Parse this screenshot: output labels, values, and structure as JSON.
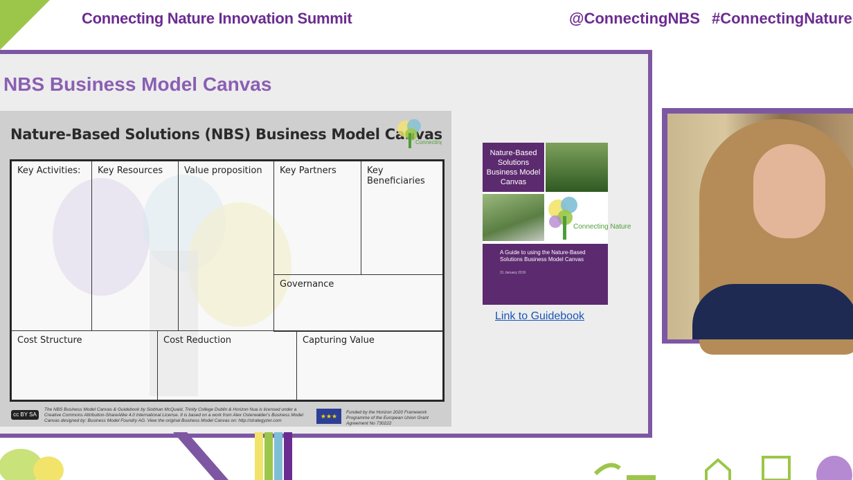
{
  "header": {
    "title": "Connecting Nature Innovation Summit",
    "handle": "@ConnectingNBS",
    "hashtag": "#ConnectingNatureS"
  },
  "slide": {
    "heading": "NBS Business Model Canvas",
    "canvas": {
      "title": "Nature-Based Solutions (NBS) Business Model Canvas",
      "logo_text": "Connecting Nature",
      "cells": {
        "key_activities": "Key Activities:",
        "key_resources": "Key Resources",
        "value_proposition": "Value proposition",
        "key_partners": "Key Partners",
        "key_beneficiaries": "Key Beneficiaries",
        "governance": "Governance",
        "cost_structure": "Cost Structure",
        "cost_reduction": "Cost Reduction",
        "capturing_value": "Capturing Value"
      },
      "credits": "The NBS Business Model Canvas & Guidebook by Siobhan McQuaid, Trinity College Dublin & Horizon Nua is licensed under a Creative Commons Attribution-ShareAlike 4.0 International License. It is based on a work from Alex Osterwalder's Business Model Canvas designed by: Business Model Foundry AG. View the original Business Model Canvas on: http://strategyzer.com",
      "funding": "Funded by the Horizon 2020 Framework Programme of the European Union Grant Agreement No 730222",
      "cc_badge": "cc BY SA",
      "eu_flag": "★★★"
    },
    "guidebook": {
      "cover_title": "Nature-Based Solutions Business Model Canvas",
      "logo_text": "Connecting Nature",
      "subtitle": "A Guide to using the Nature-Based Solutions Business Model Canvas",
      "date": "31 January 2019",
      "link": "Link to Guidebook"
    }
  },
  "colors": {
    "brand_purple": "#6b2c91",
    "frame_purple": "#7e57a3",
    "heading_purple": "#8a5fb3",
    "link_blue": "#1a55b8"
  }
}
